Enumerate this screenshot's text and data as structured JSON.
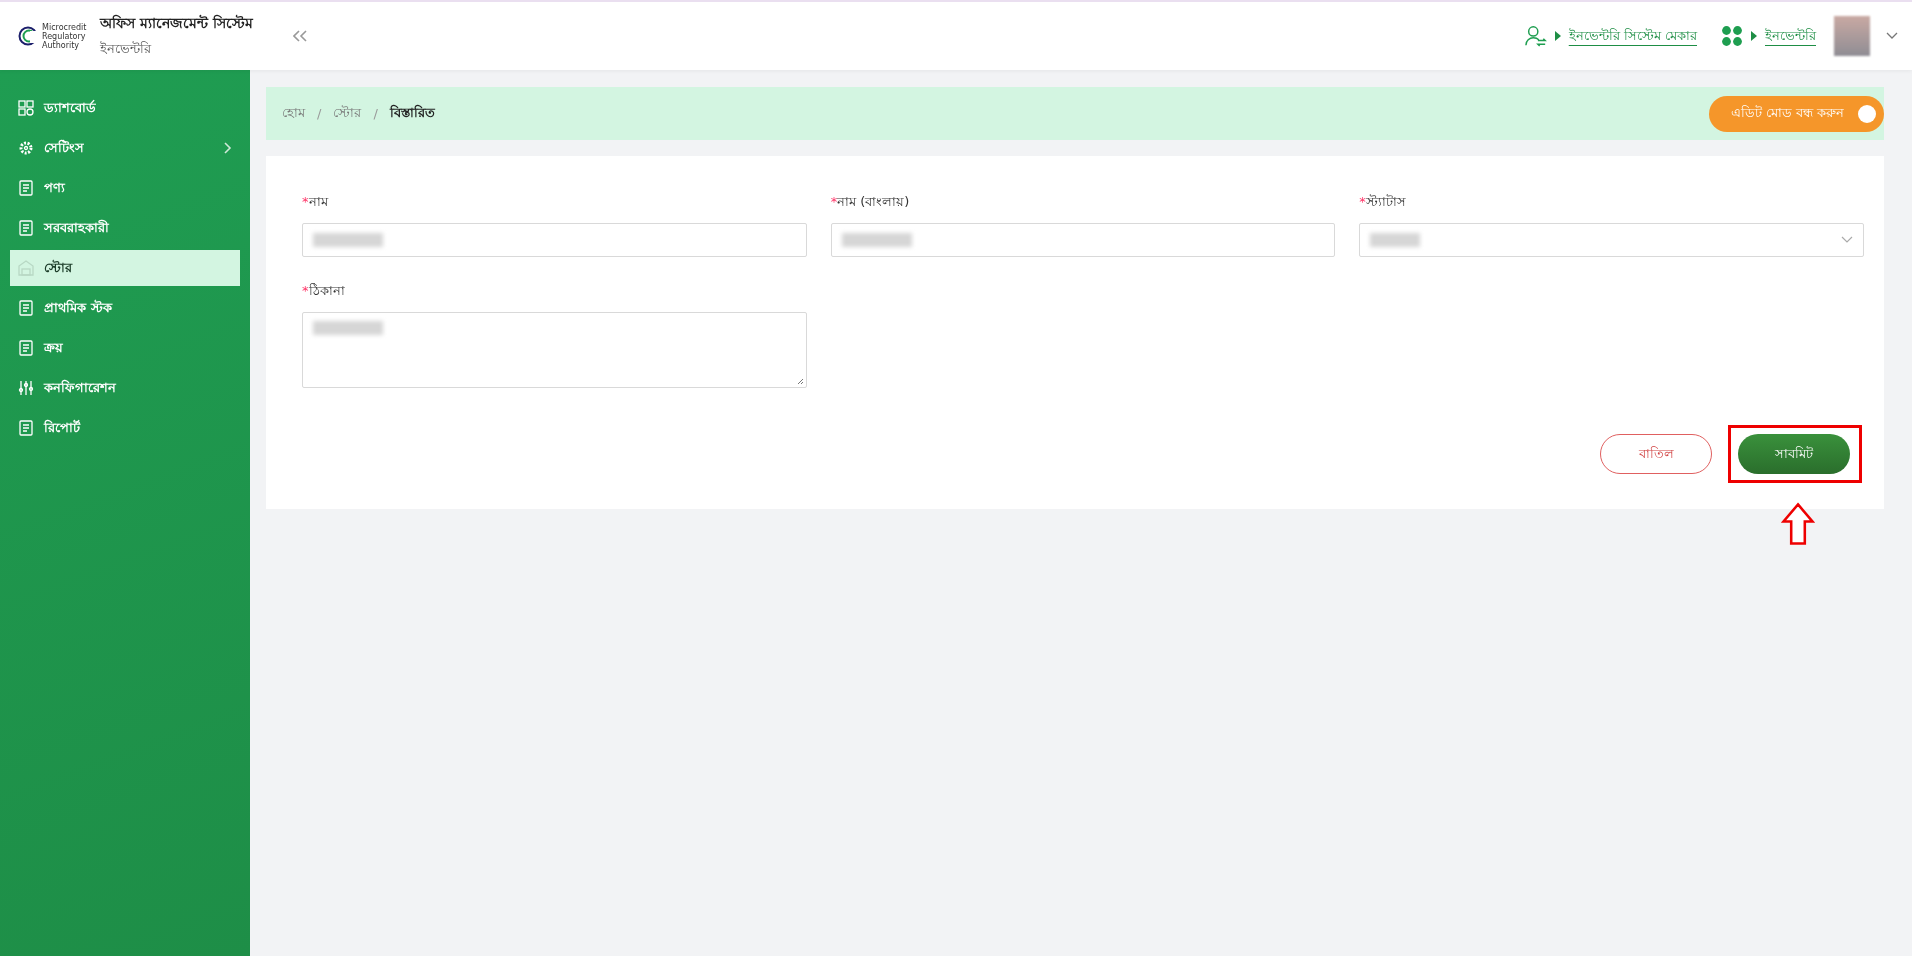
{
  "header": {
    "logo": {
      "lines": [
        "Microcredit",
        "Regulatory",
        "Authority"
      ]
    },
    "app_title": "অফিস ম্যানেজমেন্ট সিস্টেম",
    "app_subtitle": "ইনভেন্টরি",
    "role_link": "ইনভেন্টরি সিস্টেম মেকার",
    "module_link": "ইনভেন্টরি"
  },
  "sidebar": {
    "items": [
      {
        "label": "ড্যাশবোর্ড",
        "kind": "link",
        "selected": false
      },
      {
        "label": "সেটিংস",
        "kind": "group",
        "selected": false
      },
      {
        "label": "পণ্য",
        "kind": "link",
        "selected": false
      },
      {
        "label": "সরবরাহকারী",
        "kind": "link",
        "selected": false
      },
      {
        "label": "স্টোর",
        "kind": "link",
        "selected": true
      },
      {
        "label": "প্রাথমিক স্টক",
        "kind": "link",
        "selected": false
      },
      {
        "label": "ক্রয়",
        "kind": "link",
        "selected": false
      },
      {
        "label": "কনফিগারেশন",
        "kind": "link",
        "selected": false
      },
      {
        "label": "রিপোর্ট",
        "kind": "link",
        "selected": false
      }
    ]
  },
  "breadcrumb": [
    "হোম",
    "স্টোর",
    "বিস্তারিত"
  ],
  "breadcrumb_separator": "/",
  "edit_mode_toggle": {
    "label": "এডিট মোড বন্ধ করুন",
    "on": true
  },
  "form": {
    "required_mark": "*",
    "fields": [
      {
        "label": "নাম",
        "kind": "input",
        "required": true
      },
      {
        "label": "নাম (বাংলায়)",
        "kind": "input",
        "required": true
      },
      {
        "label": "স্ট্যাটাস",
        "kind": "select",
        "required": true
      },
      {
        "label": "ঠিকানা",
        "kind": "textarea",
        "required": true
      }
    ],
    "buttons": [
      {
        "label": "বাতিল",
        "kind": "cancel",
        "highlighted": false
      },
      {
        "label": "সাবমিট",
        "kind": "submit",
        "highlighted": true
      }
    ]
  }
}
